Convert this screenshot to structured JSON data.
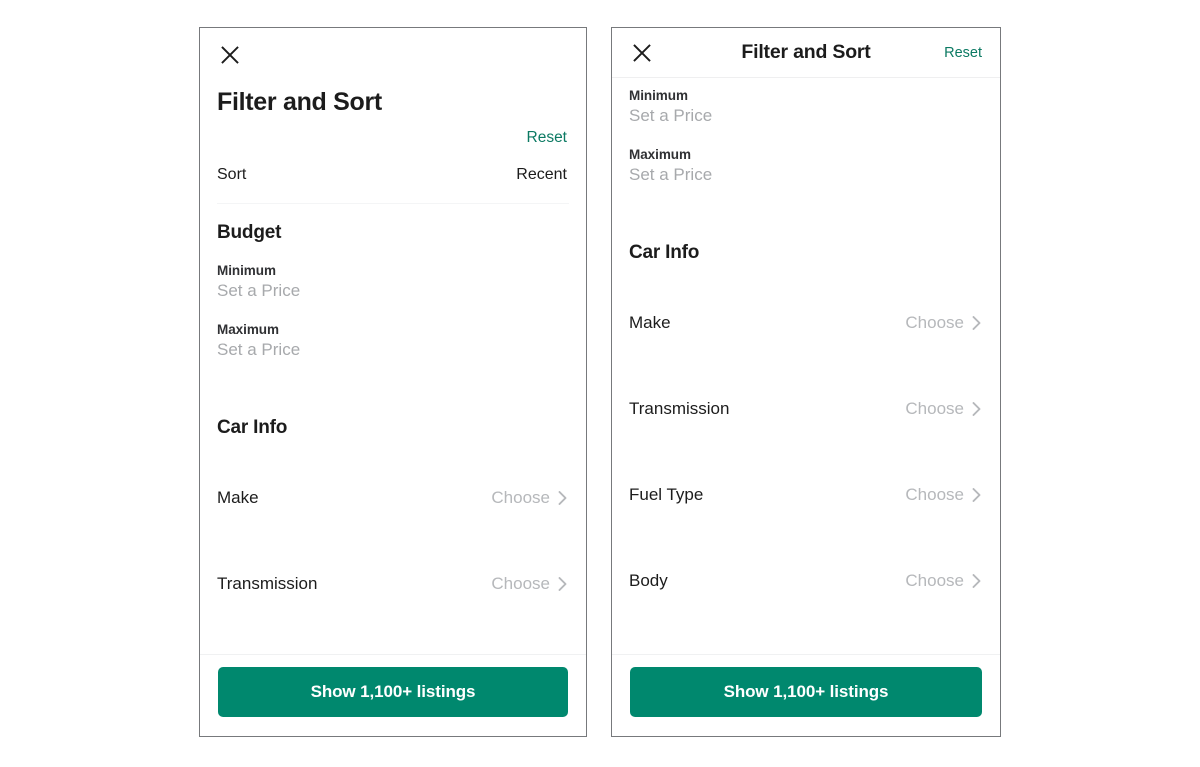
{
  "panels": {
    "left": {
      "close_icon": "close-icon",
      "title": "Filter and Sort",
      "reset_label": "Reset",
      "sort": {
        "label": "Sort",
        "value": "Recent"
      },
      "budget": {
        "section_title": "Budget",
        "fields": [
          {
            "label": "Minimum",
            "placeholder": "Set a Price",
            "value": ""
          },
          {
            "label": "Maximum",
            "placeholder": "Set a Price",
            "value": ""
          }
        ]
      },
      "car_info": {
        "section_title": "Car Info",
        "rows": [
          {
            "label": "Make",
            "value": "Choose",
            "chevron": "chevron-right-icon"
          },
          {
            "label": "Transmission",
            "value": "Choose",
            "chevron": "chevron-right-icon"
          }
        ]
      },
      "cta_label": "Show 1,100+ listings"
    },
    "right": {
      "close_icon": "close-icon",
      "title": "Filter and Sort",
      "reset_label": "Reset",
      "budget": {
        "fields": [
          {
            "label": "Minimum",
            "placeholder": "Set a Price",
            "value": ""
          },
          {
            "label": "Maximum",
            "placeholder": "Set a Price",
            "value": ""
          }
        ]
      },
      "car_info": {
        "section_title": "Car Info",
        "rows": [
          {
            "label": "Make",
            "value": "Choose",
            "chevron": "chevron-right-icon"
          },
          {
            "label": "Transmission",
            "value": "Choose",
            "chevron": "chevron-right-icon"
          },
          {
            "label": "Fuel Type",
            "value": "Choose",
            "chevron": "chevron-right-icon"
          },
          {
            "label": "Body",
            "value": "Choose",
            "chevron": "chevron-right-icon"
          }
        ]
      },
      "cta_label": "Show 1,100+ listings"
    }
  },
  "colors": {
    "accent_green": "#00886e",
    "link_green": "#0c7a63",
    "text_primary": "#1c1c1c",
    "text_muted": "#a7a9ac",
    "divider": "#f0f1f2",
    "panel_border": "#77797c"
  }
}
